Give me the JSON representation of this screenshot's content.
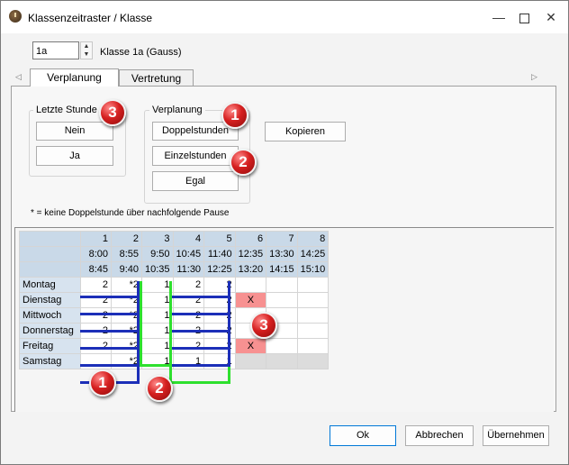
{
  "window": {
    "title": "Klassenzeitraster / Klasse"
  },
  "class_selector": {
    "value": "1a",
    "label": "Klasse 1a (Gauss)"
  },
  "tabs": [
    {
      "label": "Verplanung"
    },
    {
      "label": "Vertretung"
    }
  ],
  "letzte_stunde": {
    "title": "Letzte Stunde",
    "nein": "Nein",
    "ja": "Ja"
  },
  "verplanung": {
    "title": "Verplanung",
    "doppelstunden": "Doppelstunden",
    "einzelstunden": "Einzelstunden",
    "egal": "Egal"
  },
  "kopieren": "Kopieren",
  "footnote": "* = keine Doppelstunde über nachfolgende Pause",
  "grid": {
    "periods": [
      "1",
      "2",
      "3",
      "4",
      "5",
      "6",
      "7",
      "8"
    ],
    "starts": [
      "8:00",
      "8:55",
      "9:50",
      "10:45",
      "11:40",
      "12:35",
      "13:30",
      "14:25"
    ],
    "ends": [
      "8:45",
      "9:40",
      "10:35",
      "11:30",
      "12:25",
      "13:20",
      "14:15",
      "15:10"
    ],
    "rows": [
      {
        "day": "Montag",
        "cells": [
          "2",
          "*2",
          "1",
          "2",
          "2",
          "",
          "",
          ""
        ]
      },
      {
        "day": "Dienstag",
        "cells": [
          "2",
          "*2",
          "1",
          "2",
          "2",
          "X",
          "",
          ""
        ]
      },
      {
        "day": "Mittwoch",
        "cells": [
          "2",
          "*2",
          "1",
          "2",
          "2",
          "",
          "",
          ""
        ]
      },
      {
        "day": "Donnerstag",
        "cells": [
          "2",
          "*2",
          "1",
          "2",
          "2",
          "",
          "",
          ""
        ]
      },
      {
        "day": "Freitag",
        "cells": [
          "2",
          "*2",
          "1",
          "2",
          "2",
          "X",
          "",
          ""
        ]
      },
      {
        "day": "Samstag",
        "cells": [
          "",
          "*2",
          "1",
          "1",
          "1",
          "",
          "",
          ""
        ]
      }
    ]
  },
  "badges": {
    "b1": "1",
    "b2": "2",
    "b3": "3"
  },
  "footer": {
    "ok": "Ok",
    "abbrechen": "Abbrechen",
    "uebernehmen": "Übernehmen"
  },
  "colors": {
    "blue_marker": "#1c2fb8",
    "green_marker": "#2ee02e",
    "x_cell": "#f79191",
    "header": "#c9d9e8",
    "badge": "#d62020"
  },
  "icons": {
    "app": "clock-icon",
    "minimize": "minimize-icon",
    "maximize": "maximize-icon",
    "close": "close-icon"
  }
}
